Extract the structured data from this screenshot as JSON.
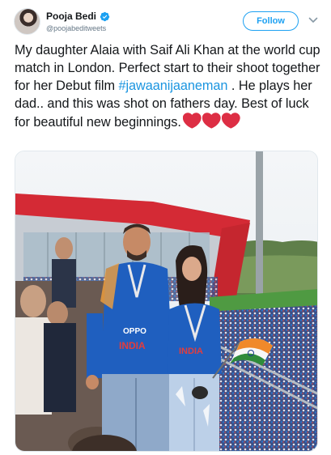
{
  "tweet": {
    "display_name": "Pooja Bedi",
    "handle": "@poojabeditweets",
    "follow_label": "Follow",
    "text_before": "My daughter Alaia with Saif Ali Khan at the world cup match in London. Perfect start to their shoot together for her Debut film ",
    "hashtag": "#jawaanijaaneman",
    "text_after": " . He plays her dad.. and this was shot on fathers day. Best of luck for beautiful new beginnings.",
    "emoji": [
      "heart-emoji",
      "heart-emoji",
      "heart-emoji"
    ]
  },
  "photo": {
    "jersey_brand": "OPPO",
    "jersey_country": "INDIA"
  },
  "colors": {
    "accent": "#1da1f2",
    "hashtag": "#1b95e0",
    "verified": "#1da1f2",
    "heart": "#dd2e44",
    "jersey": "#1f5fbf",
    "stand_roof": "#d42a35"
  },
  "icons": [
    "avatar",
    "verified-badge-icon",
    "chevron-down-icon",
    "heart-icon"
  ]
}
